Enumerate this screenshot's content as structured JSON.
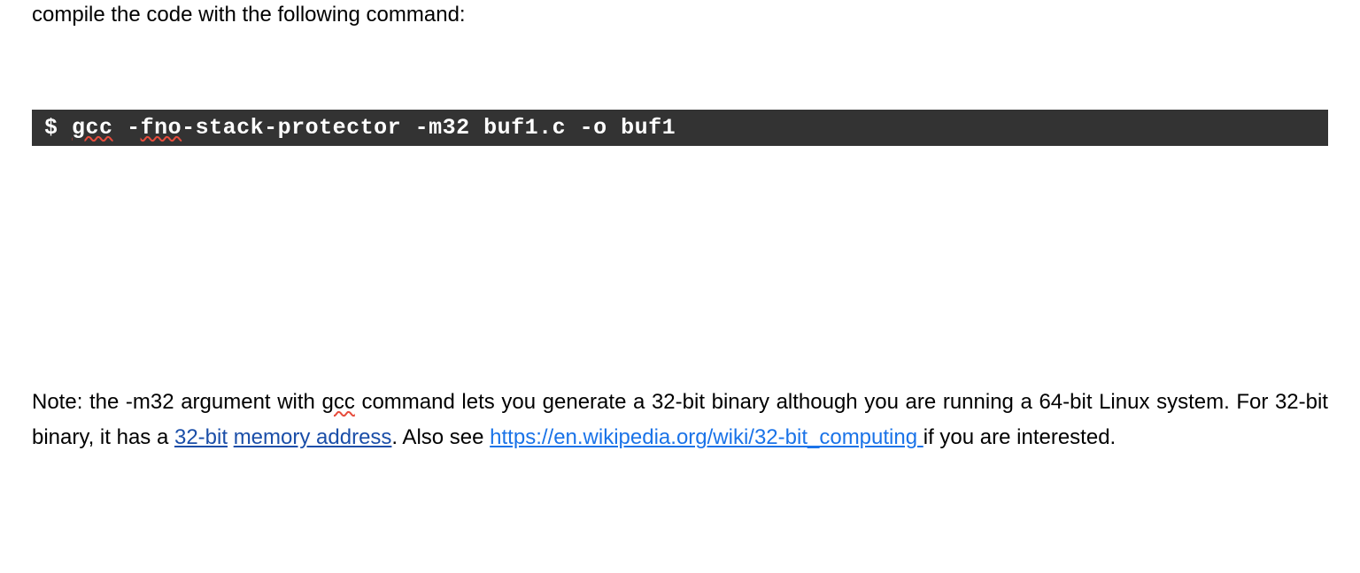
{
  "intro_text": "compile the code with the following command:",
  "terminal": {
    "prompt": "$",
    "word1": "gcc",
    "space1": " ",
    "dash": "-",
    "word2": "fno",
    "rest_cmd": "-stack-protector -m32 buf1.c -o buf1"
  },
  "note": {
    "part1": "Note: the -m32 argument with ",
    "gcc": "gcc",
    "part2": " command lets you generate a 32-bit binary although you are running a 64-bit Linux system. For 32-bit binary, it has a ",
    "link1_a": "32-bit",
    "space": " ",
    "link1_b": "memory address",
    "part3": ". Also see ",
    "link2": "https://en.wikipedia.org/wiki/32-bit_computing ",
    "part4": "if you are interested."
  }
}
